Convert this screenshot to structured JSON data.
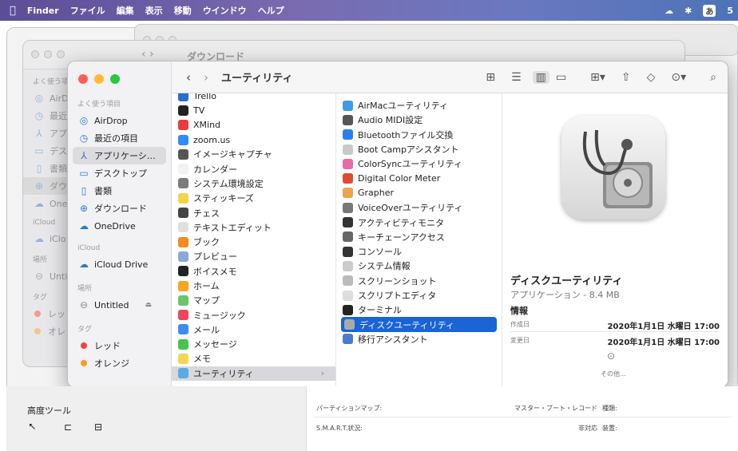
{
  "menubar": {
    "apple": "",
    "items": [
      "Finder",
      "ファイル",
      "編集",
      "表示",
      "移動",
      "ウインドウ",
      "ヘルプ"
    ],
    "status": {
      "ime": "あ",
      "extra": "5"
    }
  },
  "background_window": {
    "title": "ダウンロード",
    "sidebar_section_fav": "よく使う項目",
    "sidebar_items": [
      "AirD",
      "最近",
      "アプ",
      "デス",
      "書類",
      "ダウ",
      "One"
    ],
    "icloud_section": "iCloud",
    "icloud_item": "iClo",
    "places_section": "場所",
    "places_item": "Unti",
    "tags_section": "タグ",
    "tags": [
      "レッ",
      "オレ"
    ]
  },
  "window": {
    "title": "ユーティリティ",
    "sidebar": {
      "fav_section": "よく使う項目",
      "favorites": [
        {
          "label": "AirDrop",
          "icon": "airdrop-icon",
          "glyph": "◎"
        },
        {
          "label": "最近の項目",
          "icon": "clock-icon",
          "glyph": "◷"
        },
        {
          "label": "アプリケーシ…",
          "icon": "apps-icon",
          "glyph": "⅄"
        },
        {
          "label": "デスクトップ",
          "icon": "desktop-icon",
          "glyph": "▭"
        },
        {
          "label": "書類",
          "icon": "document-icon",
          "glyph": "▯"
        },
        {
          "label": "ダウンロード",
          "icon": "download-icon",
          "glyph": "⊕"
        },
        {
          "label": "OneDrive",
          "icon": "cloud-icon",
          "glyph": "☁"
        }
      ],
      "icloud_section": "iCloud",
      "icloud": [
        {
          "label": "iCloud Drive",
          "icon": "icloud-icon",
          "glyph": "☁"
        }
      ],
      "places_section": "場所",
      "places": [
        {
          "label": "Untitled",
          "icon": "disk-icon",
          "glyph": "⊖",
          "eject": "⏏"
        }
      ],
      "tags_section": "タグ",
      "tags": [
        {
          "label": "レッド",
          "color": "#f0453a"
        },
        {
          "label": "オレンジ",
          "color": "#f89a2b"
        }
      ]
    },
    "apps": [
      {
        "label": "Trello",
        "color": "#2a6fd0"
      },
      {
        "label": "TV",
        "color": "#222222"
      },
      {
        "label": "XMind",
        "color": "#e53c3c"
      },
      {
        "label": "zoom.us",
        "color": "#2d8cff"
      },
      {
        "label": "イメージキャプチャ",
        "color": "#555555"
      },
      {
        "label": "カレンダー",
        "color": "#f2f2f2"
      },
      {
        "label": "システム環境設定",
        "color": "#7b7b7b"
      },
      {
        "label": "スティッキーズ",
        "color": "#f5d34a"
      },
      {
        "label": "チェス",
        "color": "#444444"
      },
      {
        "label": "テキストエディット",
        "color": "#e0e0e0"
      },
      {
        "label": "ブック",
        "color": "#f58a1f"
      },
      {
        "label": "プレビュー",
        "color": "#8aa8d8"
      },
      {
        "label": "ボイスメモ",
        "color": "#222222"
      },
      {
        "label": "ホーム",
        "color": "#f7a51e"
      },
      {
        "label": "マップ",
        "color": "#6ac46a"
      },
      {
        "label": "ミュージック",
        "color": "#f2455a"
      },
      {
        "label": "メール",
        "color": "#3a8ef0"
      },
      {
        "label": "メッセージ",
        "color": "#44c64a"
      },
      {
        "label": "メモ",
        "color": "#f7d54e"
      },
      {
        "label": "ユーティリティ",
        "color": "#5aaae6"
      }
    ],
    "utilities": [
      {
        "label": "AirMacユーティリティ",
        "color": "#3f9be6"
      },
      {
        "label": "Audio MIDI設定",
        "color": "#555555"
      },
      {
        "label": "Bluetoothファイル交換",
        "color": "#2a7ff0"
      },
      {
        "label": "Boot Campアシスタント",
        "color": "#c9c9c9"
      },
      {
        "label": "ColorSyncユーティリティ",
        "color": "#e86aa6"
      },
      {
        "label": "Digital Color Meter",
        "color": "#e14a32"
      },
      {
        "label": "Grapher",
        "color": "#e9a54a"
      },
      {
        "label": "VoiceOverユーティリティ",
        "color": "#777777"
      },
      {
        "label": "アクティビティモニタ",
        "color": "#333333"
      },
      {
        "label": "キーチェーンアクセス",
        "color": "#666666"
      },
      {
        "label": "コンソール",
        "color": "#333333"
      },
      {
        "label": "システム情報",
        "color": "#cccccc"
      },
      {
        "label": "スクリーンショット",
        "color": "#bbbbbb"
      },
      {
        "label": "スクリプトエディタ",
        "color": "#dddddd"
      },
      {
        "label": "ターミナル",
        "color": "#222222"
      },
      {
        "label": "ディスクユーティリティ",
        "color": "#aaaaaa"
      },
      {
        "label": "移行アシスタント",
        "color": "#4a7bd0"
      }
    ],
    "preview": {
      "name": "ディスクユーティリティ",
      "subtitle": "アプリケーション - 8.4 MB",
      "info_header": "情報",
      "created_label": "作成日",
      "created_value": "2020年1月1日 水曜日 17:00",
      "modified_label": "変更日",
      "modified_value": "2020年1月1日 水曜日 17:00",
      "more_label": "その他..."
    }
  },
  "bottom_panel": {
    "tools_label": "高度ツール",
    "rows": [
      {
        "label": "パーティションマップ:",
        "value": "マスター・ブート・レコード",
        "extra": "種類:"
      },
      {
        "label": "S.M.A.R.T.状況:",
        "value": "非対応",
        "extra": "装置:"
      }
    ]
  }
}
